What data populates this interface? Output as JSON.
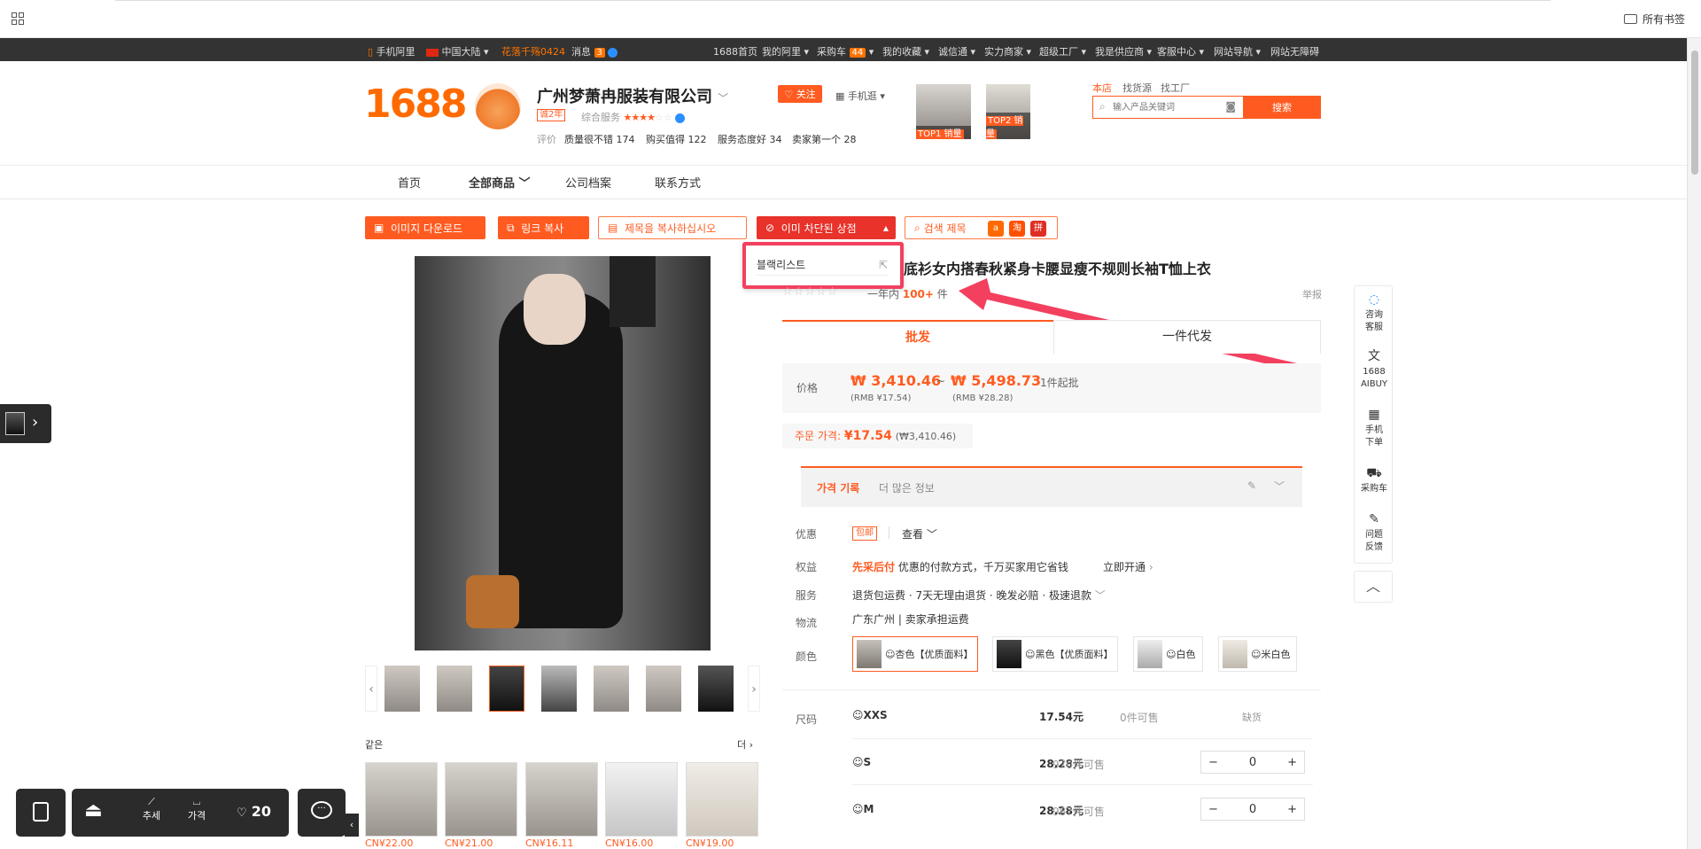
{
  "browser": {
    "bookmarks_label": "所有书签"
  },
  "topbar": {
    "mobile": "手机阿里",
    "region": "中国大陆",
    "nickname": "花落千殇0424",
    "messages": "消息",
    "msg_count": "3",
    "links": [
      "1688首页",
      "我的阿里",
      "采购车",
      "我的收藏",
      "诚信通",
      "实力商家",
      "超级工厂",
      "我是供应商",
      "客服中心",
      "网站导航",
      "网站无障碍"
    ],
    "cart_count": "44"
  },
  "header": {
    "logo": "1688",
    "shop_name": "广州梦萧冉服装有限公司",
    "years": "诚2年",
    "service_label": "综合服务",
    "eval_label": "评价",
    "tags": [
      "质量很不错 174",
      "购买值得 122",
      "服务态度好 34",
      "卖家第一个 28"
    ],
    "follow": "关注",
    "mobile_shop": "手机逛",
    "top1": "TOP1 销量",
    "top2": "TOP2 销量",
    "search_tabs": [
      "本店",
      "找货源",
      "找工厂"
    ],
    "search_placeholder": "输入产品关键词",
    "search_btn": "搜索"
  },
  "nav": [
    "首页",
    "全部商品",
    "公司档案",
    "联系方式"
  ],
  "toolbar": {
    "download": "이미지 다운로드",
    "copy_link": "링크 복사",
    "copy_title": "제목을 복사하십시오",
    "blocked": "이미 차단된 상점",
    "search_title": "검색 제목",
    "taobao": "淘",
    "pdd": "拼"
  },
  "dropdown": {
    "blacklist": "블랙리스트"
  },
  "product": {
    "title": "底衫女内搭春秋紧身卡腰显瘦不规则长袖T恤上衣",
    "sales_prefix": "一年内",
    "sales": "100+",
    "sales_suffix": "件",
    "report": "举报",
    "tab_wholesale": "批发",
    "tab_dropship": "一件代发",
    "price_label": "价格",
    "price_low": "₩ 3,410.46",
    "price_sep": "~",
    "price_high": "₩ 5,498.73",
    "moq": "1件起批",
    "rmb_low": "(RMB ¥17.54)",
    "rmb_high": "(RMB ¥28.28)",
    "order_price_label": "주문 가격:",
    "order_price": "¥17.54",
    "order_price_krw": "(₩3,410.46)",
    "history_label": "가격 기록",
    "more_info": "더 많은 정보",
    "promo_label": "优惠",
    "promo_tag": "包邮",
    "promo_view": "查看",
    "rights_label": "权益",
    "rights_name": "先采后付",
    "rights_desc": "优惠的付款方式，千万买家用它省钱",
    "rights_link": "立即开通",
    "service_label": "服务",
    "service_desc": "退货包运费 · 7天无理由退货 · 晚发必赔 · 极速退款",
    "logistics_label": "物流",
    "logistics_from": "广东广州",
    "logistics_fee": "卖家承担运费",
    "color_label": "颜色",
    "colors": [
      "☺杏色【优质面料】",
      "☺黑色【优质面料】",
      "☺白色",
      "☺米白色"
    ],
    "size_label": "尺码",
    "sizes": [
      {
        "name": "☺XXS",
        "price": "17.54元",
        "stock": "0件可售",
        "state": "缺货"
      },
      {
        "name": "☺S",
        "price": "28.28元",
        "stock": "970件可售",
        "qty": "0"
      },
      {
        "name": "☺M",
        "price": "28.28元",
        "stock": "987件可售",
        "qty": "0"
      }
    ]
  },
  "related": {
    "label": "같은",
    "more": "더",
    "prices": [
      "CN¥22.00",
      "CN¥21.00",
      "CN¥16.11",
      "CN¥16.00",
      "CN¥19.00"
    ]
  },
  "sidebar": [
    {
      "icon": "chat-icon",
      "l1": "咨询",
      "l2": "客服"
    },
    {
      "icon": "translate-icon",
      "l1": "1688",
      "l2": "AIBUY"
    },
    {
      "icon": "qr-icon",
      "l1": "手机",
      "l2": "下单"
    },
    {
      "icon": "cart-icon",
      "l1": "采购车",
      "l2": ""
    },
    {
      "icon": "edit-icon",
      "l1": "问题",
      "l2": "反馈"
    }
  ],
  "bottom": {
    "trend": "추세",
    "price": "가격",
    "likes": "20"
  }
}
